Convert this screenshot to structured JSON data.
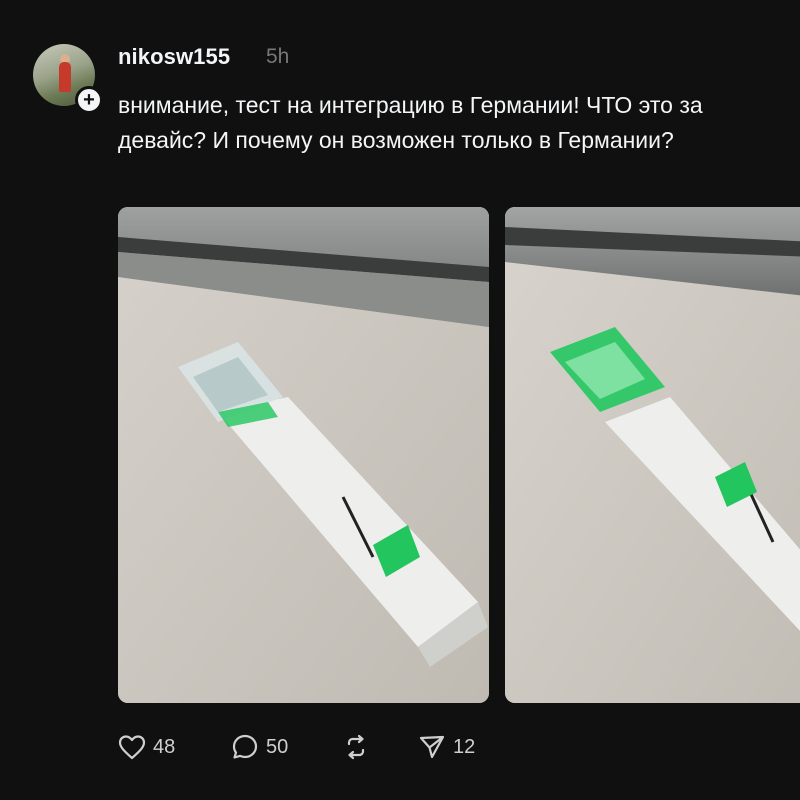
{
  "post": {
    "username": "nikosw155",
    "timestamp": "5h",
    "text": "внимание, тест на интеграцию в Германии! ЧТО это за девайс? И почему он возможен только в Германии?",
    "follow_icon": "+",
    "avatar": "avatar"
  },
  "media": [
    {
      "name": "photo-1",
      "description": "white handheld device with green button and transparent tip"
    },
    {
      "name": "photo-2",
      "description": "same device with green illuminated tip"
    }
  ],
  "actions": {
    "like": {
      "icon": "heart-icon",
      "count": "48"
    },
    "reply": {
      "icon": "comment-icon",
      "count": "50"
    },
    "repost": {
      "icon": "repost-icon",
      "count": ""
    },
    "share": {
      "icon": "send-icon",
      "count": "12"
    }
  },
  "colors": {
    "background": "#101010",
    "text": "#f3f5f7",
    "muted": "#777777",
    "accent_green": "#22c55e"
  }
}
